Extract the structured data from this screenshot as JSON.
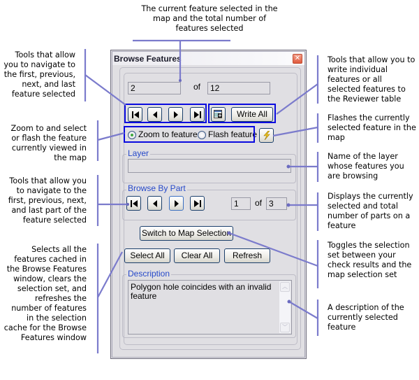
{
  "window": {
    "title": "Browse Features",
    "close_icon": "close-x-icon"
  },
  "feature_counter": {
    "current": "2",
    "of_label": "of",
    "total": "12"
  },
  "feature_nav": {
    "first_icon": "first-icon",
    "previous_icon": "previous-icon",
    "next_icon": "next-icon",
    "last_icon": "last-icon"
  },
  "write": {
    "write_feature_icon": "table-add-icon",
    "write_all_label": "Write All"
  },
  "view_mode": {
    "options": [
      {
        "label": "Zoom to feature",
        "selected": true
      },
      {
        "label": "Flash feature",
        "selected": false
      }
    ],
    "flash_icon": "lightning-icon"
  },
  "layer": {
    "group_label": "Layer",
    "value": ""
  },
  "browse_by_part": {
    "group_label": "Browse By Part",
    "current": "1",
    "of_label": "of",
    "total": "3"
  },
  "actions": {
    "switch_label": "Switch to Map Selection",
    "select_all_label": "Select All",
    "clear_all_label": "Clear All",
    "refresh_label": "Refresh"
  },
  "description": {
    "group_label": "Description",
    "text": "Polygon hole coincides with an invalid feature"
  },
  "callouts": {
    "top": "The current feature selected in the map and the total number of features selected",
    "left_nav": "Tools that allow you to navigate to the first, previous, next, and last feature selected",
    "left_zoom": "Zoom to and select or flash the feature currently viewed in the map",
    "left_parts": "Tools that allow you to navigate to the first, previous, next, and last part of the feature selected",
    "left_select": "Selects all the features cached in the Browse Features window, clears the selection set, and refreshes the number of features in the selection cache for the Browse Features window",
    "right_write": "Tools that allow you to write individual features or all selected features to the Reviewer table",
    "right_flash": "Flashes the currently selected feature in the map",
    "right_layer": "Name of the layer whose features you are browsing",
    "right_parts": "Displays the currently selected and total number of parts on a feature",
    "right_toggle": "Toggles the selection set between your check results and the map selection set",
    "right_description": "A description of the currently selected feature"
  },
  "colors": {
    "callout_line": "#7b7bcc",
    "highlight_box": "#0a0adf",
    "group_title": "#2649c9",
    "window_bg": "#e0dfe3"
  }
}
